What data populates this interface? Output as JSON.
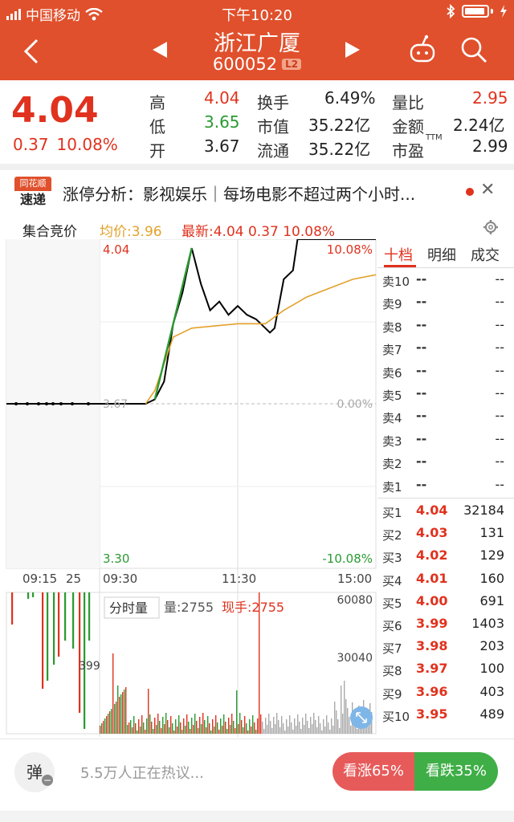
{
  "status": {
    "carrier": "中国移动",
    "time": "下午10:20"
  },
  "nav": {
    "title": "浙江广厦",
    "code": "600052",
    "badge": "L2"
  },
  "quote": {
    "price": "4.04",
    "change": "0.37",
    "pct": "10.08%",
    "fields": [
      {
        "label": "高",
        "value": "4.04",
        "color": "red"
      },
      {
        "label": "低",
        "value": "3.65",
        "color": "green"
      },
      {
        "label": "开",
        "value": "3.67",
        "color": "dark"
      },
      {
        "label": "换手",
        "value": "6.49%",
        "color": "dark"
      },
      {
        "label": "市值",
        "value": "35.22亿",
        "color": "dark"
      },
      {
        "label": "流通",
        "value": "35.22亿",
        "color": "dark"
      },
      {
        "label": "量比",
        "value": "2.95",
        "color": "red"
      },
      {
        "label": "金额",
        "value": "2.24亿",
        "color": "dark"
      },
      {
        "label": "市盈",
        "value": "2.99",
        "color": "dark",
        "sup": "TTM"
      }
    ]
  },
  "news": {
    "logo_top": "同花顺",
    "logo_bottom": "速递",
    "text": "涨停分析：影视娱乐｜每场电影不超过两个小时..."
  },
  "chart_header": {
    "title": "集合竞价",
    "avg": "均价:3.96",
    "last": "最新:4.04  0.37  10.08%"
  },
  "chart_data": {
    "type": "line",
    "price_axis": {
      "top": "4.04",
      "mid": "3.67",
      "bottom": "3.30",
      "top_pct": "10.08%",
      "mid_pct": "0.00%",
      "bottom_pct": "-10.08%"
    },
    "time_labels": [
      "09:15",
      "25",
      "09:30",
      "11:30",
      "15:00"
    ],
    "series": [
      {
        "color": "#000000",
        "points": [
          [
            0,
            3.67
          ],
          [
            10,
            3.67
          ],
          [
            12,
            3.68
          ],
          [
            14,
            3.72
          ],
          [
            16,
            3.85
          ],
          [
            18,
            3.92
          ],
          [
            20,
            4.02
          ],
          [
            22,
            3.94
          ],
          [
            24,
            3.88
          ],
          [
            26,
            3.9
          ],
          [
            28,
            3.87
          ],
          [
            30,
            3.89
          ],
          [
            32,
            3.87
          ],
          [
            34,
            3.86
          ],
          [
            36,
            3.84
          ],
          [
            37,
            3.83
          ],
          [
            38,
            3.84
          ],
          [
            40,
            3.95
          ],
          [
            42,
            3.97
          ],
          [
            43,
            4.04
          ],
          [
            60,
            4.04
          ]
        ]
      },
      {
        "color": "#e4a12a",
        "points": [
          [
            10,
            3.67
          ],
          [
            12,
            3.7
          ],
          [
            14,
            3.76
          ],
          [
            16,
            3.82
          ],
          [
            20,
            3.84
          ],
          [
            30,
            3.85
          ],
          [
            36,
            3.85
          ],
          [
            40,
            3.88
          ],
          [
            45,
            3.91
          ],
          [
            50,
            3.93
          ],
          [
            55,
            3.95
          ],
          [
            60,
            3.96
          ]
        ]
      }
    ],
    "volume_label": "分时量",
    "volume": "量:2755",
    "hand": "现手:2755",
    "volume_axis": {
      "top": "60080",
      "mid": "30040",
      "left": "399"
    }
  },
  "tabs": [
    "十档",
    "明细",
    "成交"
  ],
  "sell": [
    {
      "label": "卖10",
      "price": "--",
      "vol": "--"
    },
    {
      "label": "卖9",
      "price": "--",
      "vol": "--"
    },
    {
      "label": "卖8",
      "price": "--",
      "vol": "--"
    },
    {
      "label": "卖7",
      "price": "--",
      "vol": "--"
    },
    {
      "label": "卖6",
      "price": "--",
      "vol": "--"
    },
    {
      "label": "卖5",
      "price": "--",
      "vol": "--"
    },
    {
      "label": "卖4",
      "price": "--",
      "vol": "--"
    },
    {
      "label": "卖3",
      "price": "--",
      "vol": "--"
    },
    {
      "label": "卖2",
      "price": "--",
      "vol": "--"
    },
    {
      "label": "卖1",
      "price": "--",
      "vol": "--"
    }
  ],
  "buy": [
    {
      "label": "买1",
      "price": "4.04",
      "vol": "32184"
    },
    {
      "label": "买2",
      "price": "4.03",
      "vol": "131"
    },
    {
      "label": "买3",
      "price": "4.02",
      "vol": "129"
    },
    {
      "label": "买4",
      "price": "4.01",
      "vol": "160"
    },
    {
      "label": "买5",
      "price": "4.00",
      "vol": "691"
    },
    {
      "label": "买6",
      "price": "3.99",
      "vol": "1403"
    },
    {
      "label": "买7",
      "price": "3.98",
      "vol": "203"
    },
    {
      "label": "买8",
      "price": "3.97",
      "vol": "100"
    },
    {
      "label": "买9",
      "price": "3.96",
      "vol": "403"
    },
    {
      "label": "买10",
      "price": "3.95",
      "vol": "489"
    }
  ],
  "bottom": {
    "danmu": "弹",
    "discuss": "5.5万人正在热议...",
    "up": "看涨65%",
    "down": "看跌35%"
  }
}
